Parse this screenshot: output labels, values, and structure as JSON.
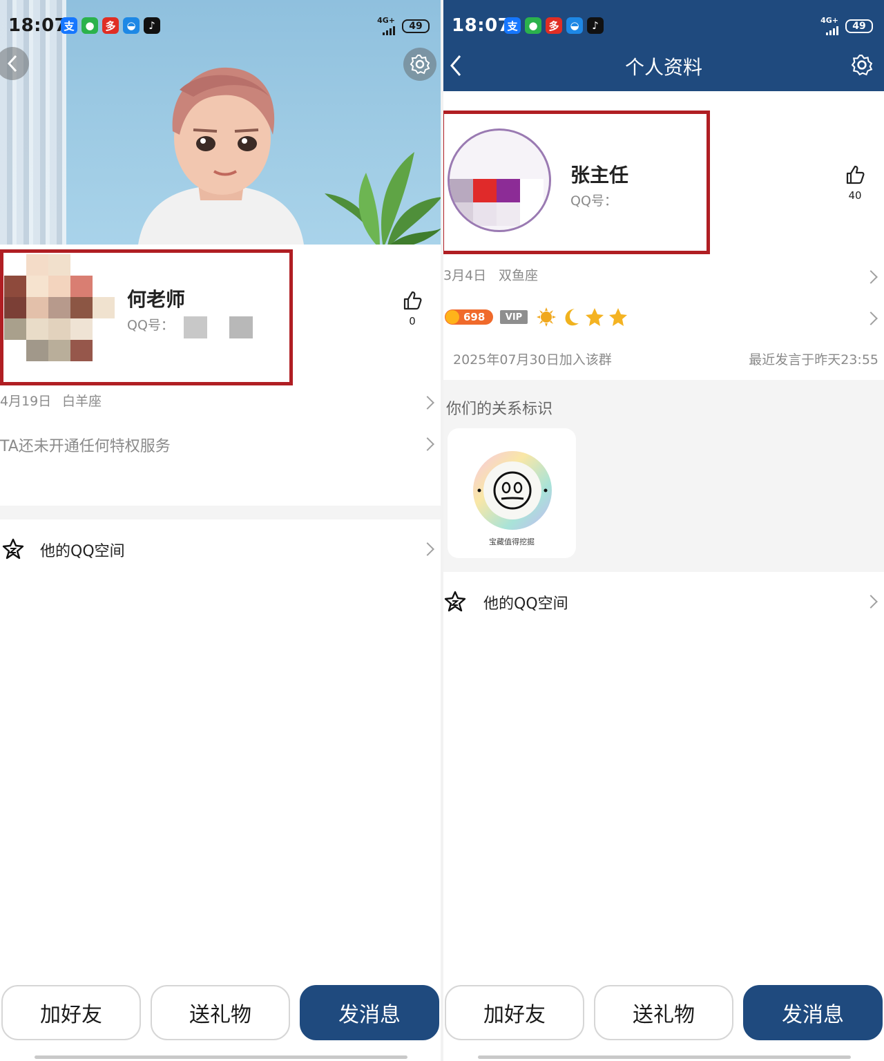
{
  "status": {
    "time": "18:07",
    "network": "4G+",
    "battery": "49",
    "apps": [
      {
        "name": "alipay-icon",
        "glyph": "支",
        "color": "#1677ff"
      },
      {
        "name": "wechat-icon",
        "glyph": "●",
        "color": "#2bb24c"
      },
      {
        "name": "pinduoduo-icon",
        "glyph": "多",
        "color": "#e02e24"
      },
      {
        "name": "cloud-app-icon",
        "glyph": "◒",
        "color": "#1e88e5"
      },
      {
        "name": "tiktok-icon",
        "glyph": "♪",
        "color": "#111111"
      }
    ]
  },
  "left": {
    "name": "何老师",
    "qq_label": "QQ号：",
    "likes": "0",
    "birthday": "4月19日",
    "zodiac": "白羊座",
    "privilege": "TA还未开通任何特权服务",
    "qzone": "他的QQ空间"
  },
  "right": {
    "header_title": "个人资料",
    "name": "张主任",
    "qq_label": "QQ号：",
    "likes": "40",
    "birthday": "3月4日",
    "zodiac": "双鱼座",
    "level_badge": "698",
    "vip_badge": "VIP",
    "joined": "2025年07月30日加入该群",
    "last_speak": "最近发言于昨天23:55",
    "relation_title": "你们的关系标识",
    "relation_badge_text": "宝藏值得挖掘",
    "qzone": "他的QQ空间"
  },
  "buttons": {
    "add_friend": "加好友",
    "send_gift": "送礼物",
    "send_message": "发消息"
  },
  "colors": {
    "accent": "#1f4a7e",
    "highlight_box": "#b01e23",
    "level_badge": "#f06a2b"
  }
}
